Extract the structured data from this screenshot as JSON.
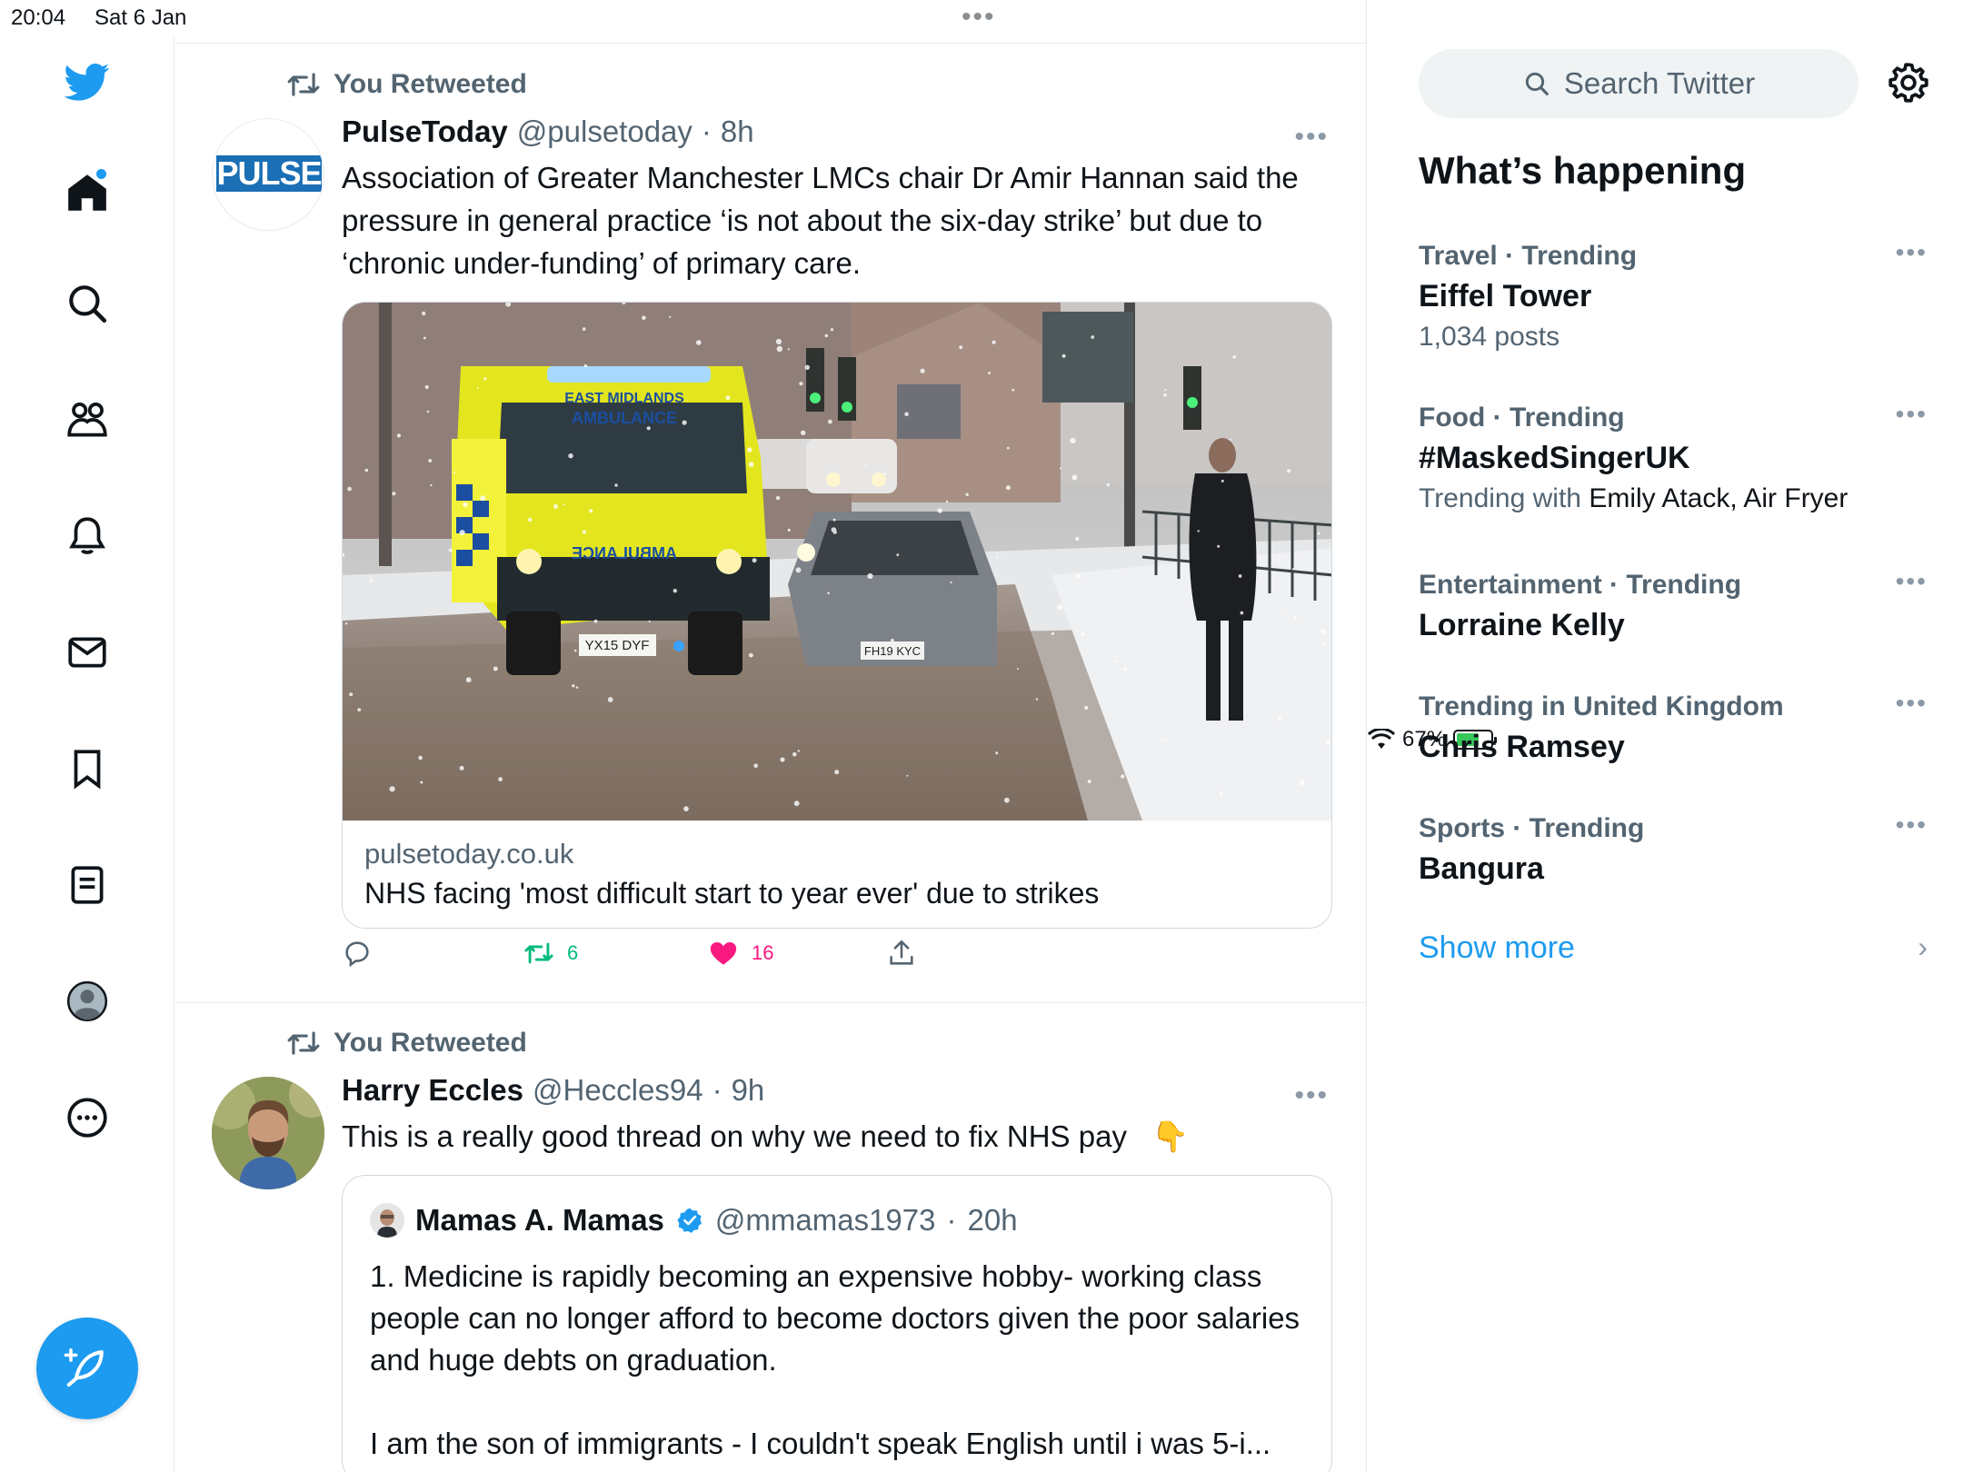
{
  "status_bar": {
    "time": "20:04",
    "date": "Sat 6 Jan",
    "battery": "67%",
    "battery_level": 0.67
  },
  "nav": {
    "items": [
      "twitter-logo",
      "home",
      "explore",
      "communities",
      "notifications",
      "messages",
      "bookmarks",
      "lists",
      "profile",
      "more"
    ],
    "home_has_new": true,
    "compose_label": "Tweet"
  },
  "tweets": [
    {
      "retweet_label": "You Retweeted",
      "author_name": "PulseToday",
      "author_handle": "@pulsetoday",
      "separator": "·",
      "age": "8h",
      "avatar_text": "PULSE",
      "text": "Association of Greater Manchester LMCs chair Dr Amir Hannan said the pressure in general practice ‘is not about the six-day strike’ but due to ‘chronic under-funding’ of primary care.",
      "card": {
        "image_text_1": "EAST MIDLANDS",
        "image_text_2": "AMBULANCE",
        "image_text_3": "AMBULANCE",
        "plate_1": "YX15 DYF",
        "plate_2": "FH19 KYC",
        "domain": "pulsetoday.co.uk",
        "title": "NHS facing 'most difficult start to year ever' due to strikes"
      },
      "retweets": "6",
      "likes": "16",
      "liked": true,
      "retweeted": true
    },
    {
      "retweet_label": "You Retweeted",
      "author_name": "Harry Eccles",
      "author_handle": "@Heccles94",
      "separator": "·",
      "age": "9h",
      "text": "This is a really good thread on why we need to fix NHS pay",
      "emoji": "👇",
      "quote": {
        "author_name": "Mamas A. Mamas",
        "author_handle": "@mmamas1973",
        "separator": "·",
        "age": "20h",
        "text_1": "1. Medicine is rapidly becoming an expensive hobby- working class people can no longer afford to become doctors given the poor salaries and huge debts on graduation.",
        "text_2": "I am the son of immigrants - I couldn't speak English until i was 5-i..."
      }
    }
  ],
  "sidebar": {
    "search_placeholder": "Search Twitter",
    "happening_title": "What’s happening",
    "trends": [
      {
        "meta": "Travel · Trending",
        "topic": "Eiffel Tower",
        "sub": "1,034 posts"
      },
      {
        "meta": "Food · Trending",
        "topic": "#MaskedSingerUK",
        "sub_prefix": "Trending with ",
        "sub_with": "Emily Atack, Air Fryer"
      },
      {
        "meta": "Entertainment · Trending",
        "topic": "Lorraine Kelly"
      },
      {
        "meta": "Trending in United Kingdom",
        "topic": "Chris Ramsey"
      },
      {
        "meta": "Sports · Trending",
        "topic": "Bangura"
      }
    ],
    "show_more": "Show more"
  },
  "colors": {
    "accent": "#1d9bf0",
    "retweet": "#00ba7c",
    "like": "#f91880",
    "muted": "#536471"
  }
}
